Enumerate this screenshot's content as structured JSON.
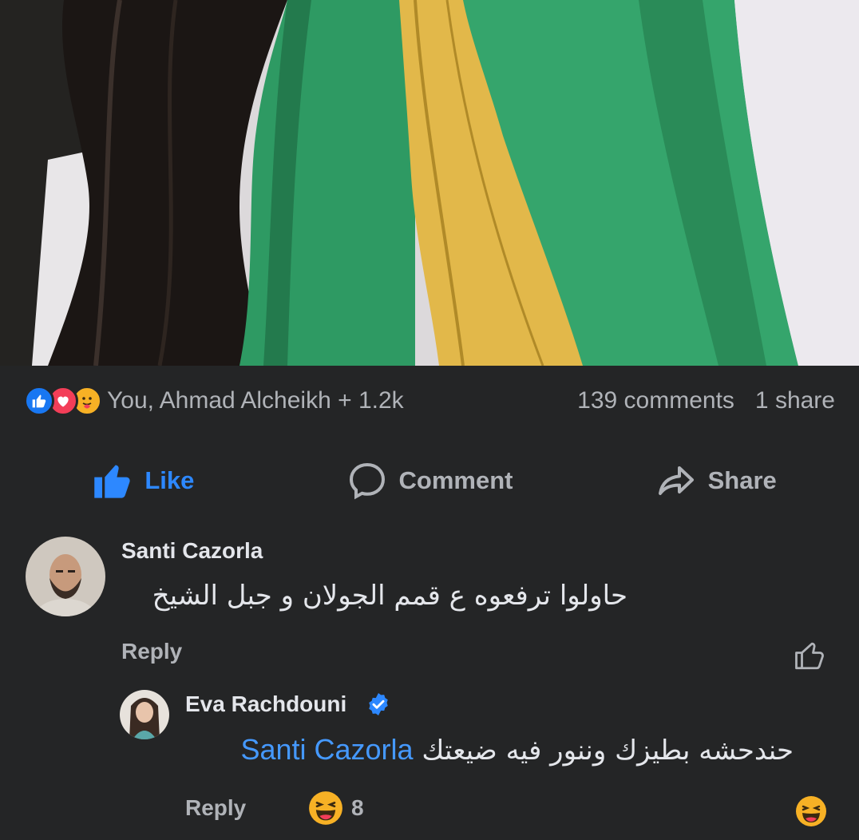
{
  "post": {
    "reactions": {
      "icons": [
        "like-reaction",
        "love-reaction",
        "care-reaction"
      ],
      "summary": "You, Ahmad Alcheikh + 1.2k"
    },
    "comments_count": "139 comments",
    "shares_count": "1 share"
  },
  "actions": {
    "like": "Like",
    "comment": "Comment",
    "share": "Share"
  },
  "comments": [
    {
      "author": "Santi Cazorla",
      "text": "حاولوا ترفعوه ع قمم الجولان و جبل الشيخ",
      "reply_label": "Reply"
    }
  ],
  "reply": {
    "author": "Eva Rachdouni",
    "verified": true,
    "mention": "Santi Cazorla",
    "text": "حندحشه بطيزك وننور فيه ضيعتك",
    "reply_label": "Reply",
    "reaction_count": "8"
  },
  "colors": {
    "background": "#242526",
    "accent": "#2d88ff",
    "secondary_text": "#b0b3b8"
  }
}
